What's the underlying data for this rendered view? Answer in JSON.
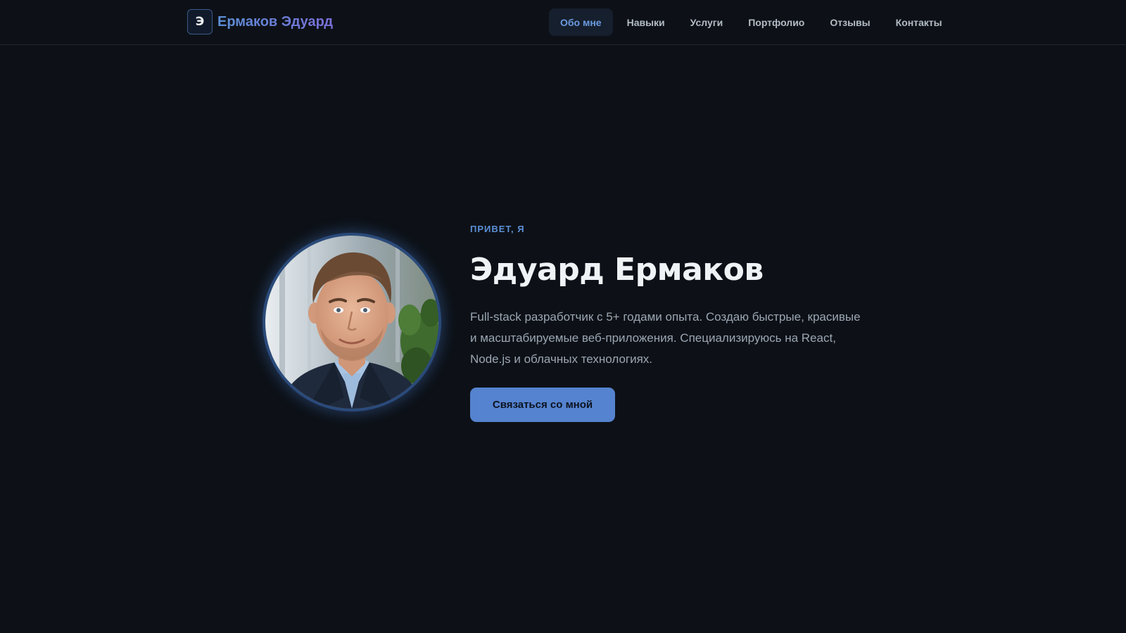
{
  "header": {
    "logo_letter": "Э",
    "brand_name": "Ермаков Эдуард",
    "nav": [
      {
        "label": "Обо мне",
        "active": true
      },
      {
        "label": "Навыки",
        "active": false
      },
      {
        "label": "Услуги",
        "active": false
      },
      {
        "label": "Портфолио",
        "active": false
      },
      {
        "label": "Отзывы",
        "active": false
      },
      {
        "label": "Контакты",
        "active": false
      }
    ]
  },
  "hero": {
    "greeting": "ПРИВЕТ, Я",
    "name": "Эдуард Ермаков",
    "description": "Full-stack разработчик с 5+ годами опыта. Создаю быстрые, красивые и масштабируемые веб-приложения. Специализируюсь на React, Node.js и облачных технологиях.",
    "cta_label": "Связаться со мной",
    "avatar_icon": "portrait-photo"
  },
  "colors": {
    "background": "#0d1117",
    "accent": "#5b8fd6",
    "button": "#5583cf",
    "text_primary": "#f0f3f6",
    "text_secondary": "#9ba6b2"
  }
}
